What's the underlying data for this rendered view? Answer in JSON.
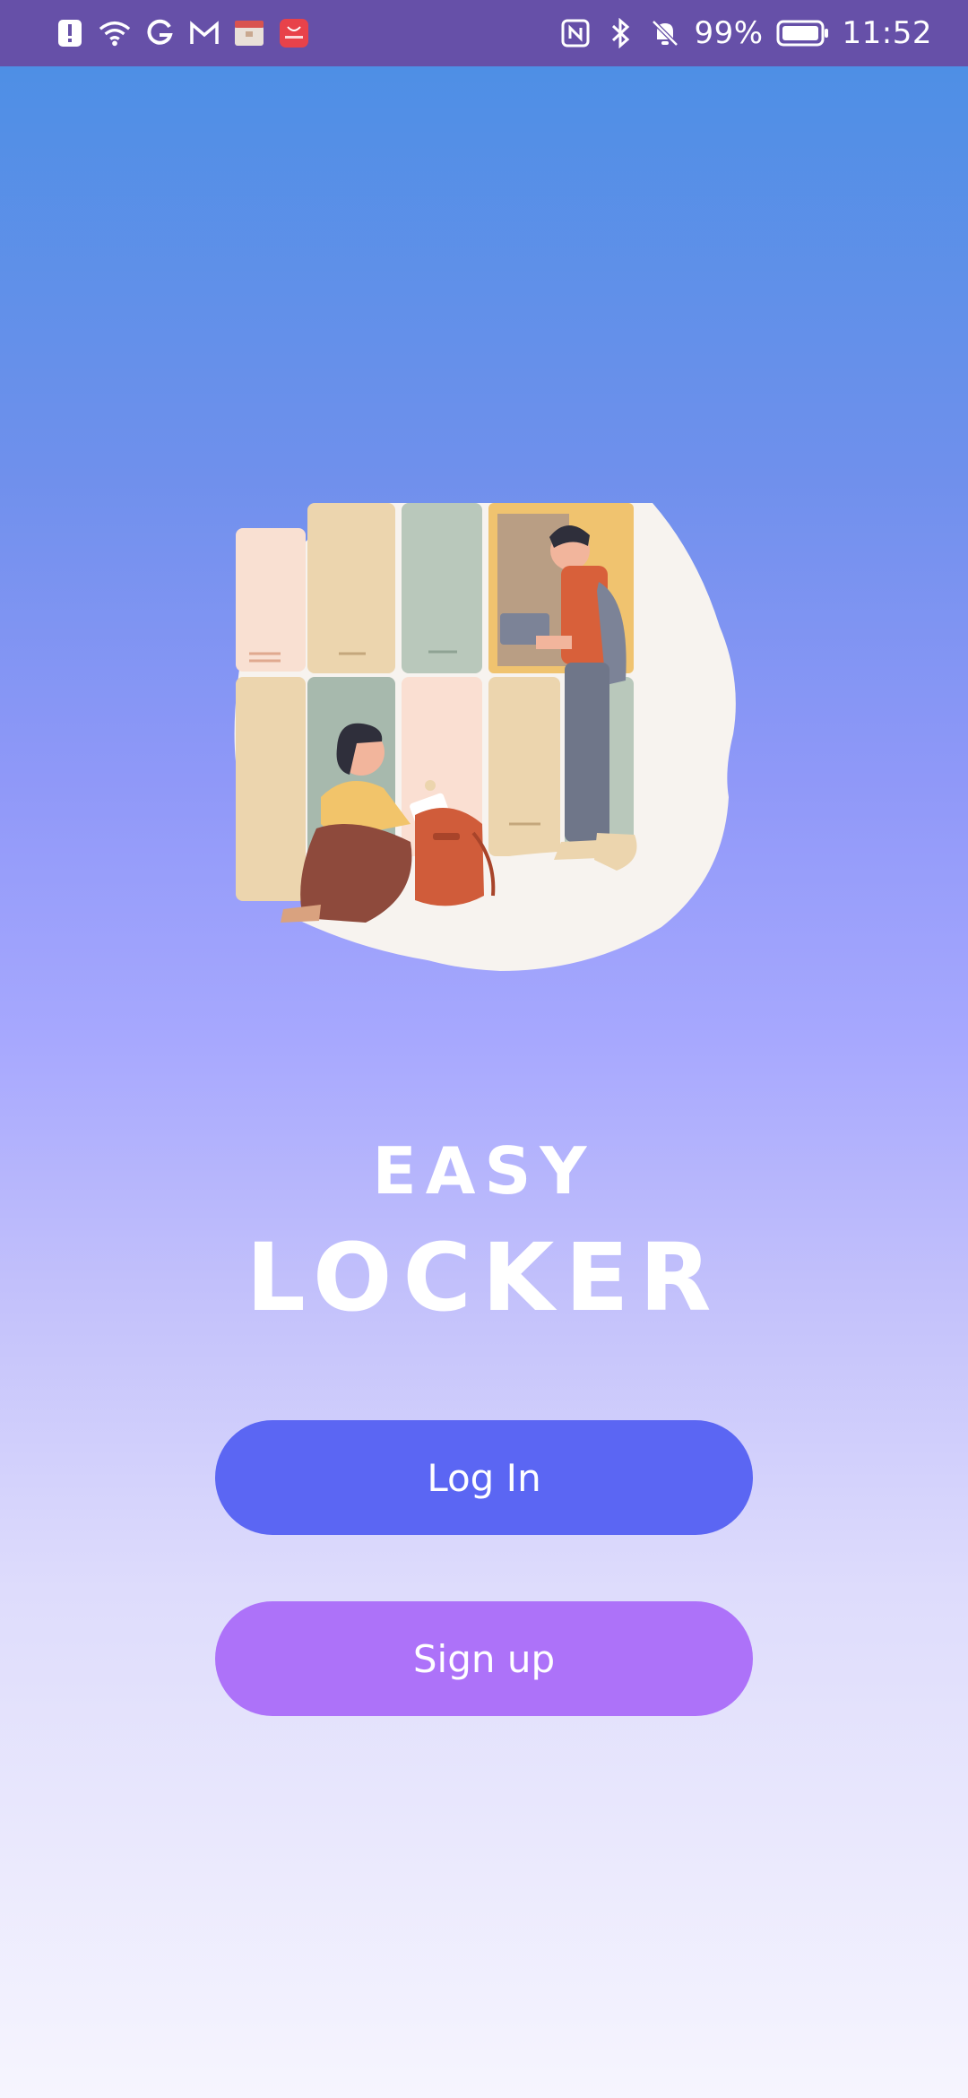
{
  "status_bar": {
    "battery_percent": "99%",
    "time": "11:52",
    "icons": [
      "alert-icon",
      "wifi-icon",
      "google-icon",
      "gmail-icon",
      "app-store-icon",
      "huawei-app-icon",
      "nfc-icon",
      "bluetooth-icon",
      "mute-icon",
      "battery-icon"
    ]
  },
  "app": {
    "title_line1": "EASY",
    "title_line2": "LOCKER"
  },
  "buttons": {
    "login_label": "Log In",
    "signup_label": "Sign up"
  },
  "colors": {
    "status_bar": "#6650a8",
    "gradient_top": "#4e8fe5",
    "gradient_bottom": "#f6f5fe",
    "login_button": "#5b66f3",
    "signup_button": "#ad72f9"
  }
}
